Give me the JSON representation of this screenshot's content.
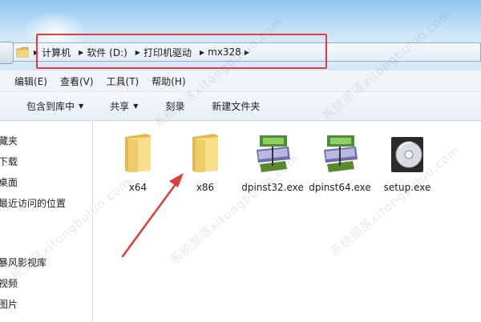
{
  "address_bar": {
    "icon": "folder-icon",
    "breadcrumbs": [
      "计算机",
      "软件 (D:)",
      "打印机驱动",
      "mx328"
    ]
  },
  "menu": [
    "编辑(E)",
    "查看(V)",
    "工具(T)",
    "帮助(H)"
  ],
  "toolbar": {
    "include_in_library": "包含到库中",
    "share": "共享",
    "burn": "刻录",
    "new_folder": "新建文件夹"
  },
  "sidebar": {
    "items": [
      "藏夹",
      "下载",
      "桌面",
      "最近访问的位置",
      "暴风影视库",
      "视频",
      "图片"
    ]
  },
  "files": [
    {
      "name": "x64",
      "icon": "folder-icon"
    },
    {
      "name": "x86",
      "icon": "folder-icon"
    },
    {
      "name": "dpinst32.exe",
      "icon": "installer-icon"
    },
    {
      "name": "dpinst64.exe",
      "icon": "installer-icon"
    },
    {
      "name": "setup.exe",
      "icon": "setup-disc-icon"
    }
  ],
  "annotation_color": "#e03c3c",
  "watermark": "系统部落xitongbuluo.com"
}
